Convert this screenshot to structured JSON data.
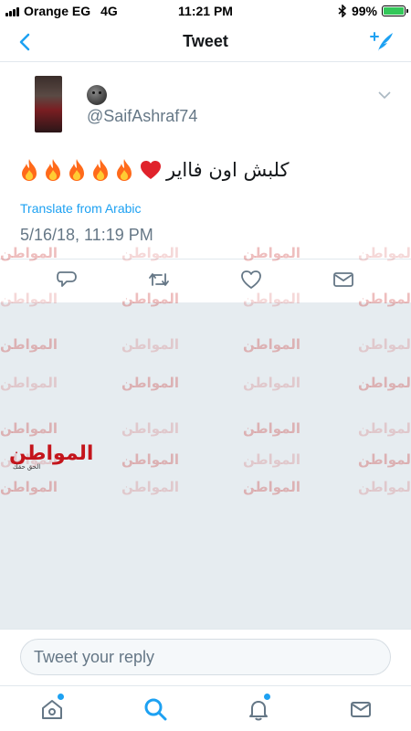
{
  "status_bar": {
    "carrier": "Orange EG",
    "network": "4G",
    "time": "11:21 PM",
    "battery_percent": "99%",
    "battery_level": 0.99,
    "icons": [
      "signal-icon",
      "bluetooth-icon",
      "battery-icon"
    ]
  },
  "nav": {
    "title": "Tweet",
    "back_icon": "chevron-left-icon",
    "compose_icon": "compose-tweet-icon"
  },
  "tweet": {
    "handle": "@SaifAshraf74",
    "display_name_emoji": "new-moon-face-icon",
    "text": "كلبش اون فااير",
    "emojis": [
      "fire-icon",
      "fire-icon",
      "fire-icon",
      "fire-icon",
      "fire-icon",
      "heart-icon"
    ],
    "translate_label": "Translate from Arabic",
    "timestamp": "5/16/18, 11:19 PM",
    "actions": [
      "reply-icon",
      "retweet-icon",
      "like-icon",
      "direct-message-icon"
    ]
  },
  "watermark": {
    "text": "المواطن",
    "subtext": "الحق حقك"
  },
  "reply": {
    "placeholder": "Tweet your reply"
  },
  "tab_bar": {
    "tabs": [
      "home-icon",
      "search-icon",
      "notifications-icon",
      "messages-icon"
    ]
  },
  "colors": {
    "accent": "#1da1f2",
    "secondary_text": "#657786",
    "background_gray": "#e6ecf0",
    "watermark_red": "#c4151c",
    "battery_green": "#33c759"
  }
}
